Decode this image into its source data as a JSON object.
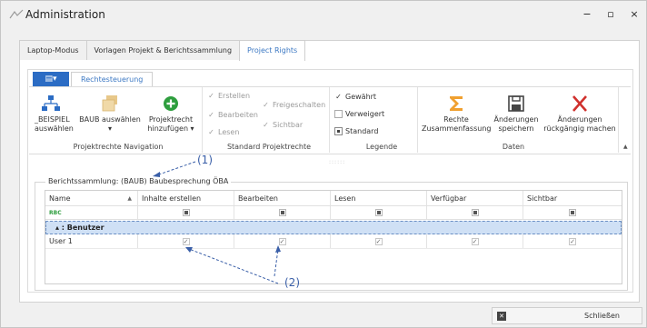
{
  "window": {
    "title": "Administration",
    "controls": {
      "minimize": "−",
      "maximize": "▫",
      "close": "×"
    }
  },
  "tabs": [
    {
      "label": "Laptop-Modus",
      "active": false
    },
    {
      "label": "Vorlagen Projekt & Berichtssammlung",
      "active": false
    },
    {
      "label": "Project Rights",
      "active": true
    }
  ],
  "ribbon": {
    "app_button": "▤▾",
    "tab_label": "Rechtesteuerung",
    "groups": {
      "navigation": {
        "label": "Projektrechte Navigation",
        "buttons": [
          {
            "line1": "_BEISPIEL",
            "line2": "auswählen",
            "icon": "hierarchy-icon"
          },
          {
            "line1": "BAUB auswählen",
            "line2": "▾",
            "icon": "folders-icon"
          },
          {
            "line1": "Projektrecht",
            "line2": "hinzufügen ▾",
            "icon": "add-circle-icon"
          }
        ]
      },
      "standard": {
        "label": "Standard Projektrechte",
        "checks": [
          "Erstellen",
          "Bearbeiten",
          "Lesen",
          "Freigeschalten",
          "Sichtbar"
        ]
      },
      "legend": {
        "label": "Legende",
        "items": [
          "Gewährt",
          "Verweigert",
          "Standard"
        ]
      },
      "data": {
        "label": "Daten",
        "buttons": [
          {
            "line1": "Rechte",
            "line2": "Zusammenfassung",
            "icon": "sigma-icon"
          },
          {
            "line1": "Änderungen",
            "line2": "speichern",
            "icon": "save-icon"
          },
          {
            "line1": "Änderungen",
            "line2": "rückgängig machen",
            "icon": "undo-x-icon"
          }
        ]
      }
    },
    "grip": "::::::",
    "collapse": "▲"
  },
  "section": {
    "legend": "Berichtssammlung: (BAUB) Baubesprechung ÖBA"
  },
  "grid": {
    "columns": [
      "Name",
      "Inhalte erstellen",
      "Bearbeiten",
      "Lesen",
      "Verfügbar",
      "Sichtbar"
    ],
    "filter_icon": "RBC",
    "group_label": "▴  : Benutzer",
    "rows": [
      {
        "name": "User 1",
        "values": [
          true,
          true,
          true,
          true,
          true
        ]
      }
    ]
  },
  "annotations": [
    "(1)",
    "(2)"
  ],
  "footer": {
    "close_label": "Schließen"
  },
  "colors": {
    "accent": "#2b6cc4",
    "group_row": "#cfe0f5",
    "annotation": "#3a5fa8",
    "delete_red": "#d0312d",
    "sigma_orange": "#f0a030",
    "add_green": "#2e9e3e"
  }
}
